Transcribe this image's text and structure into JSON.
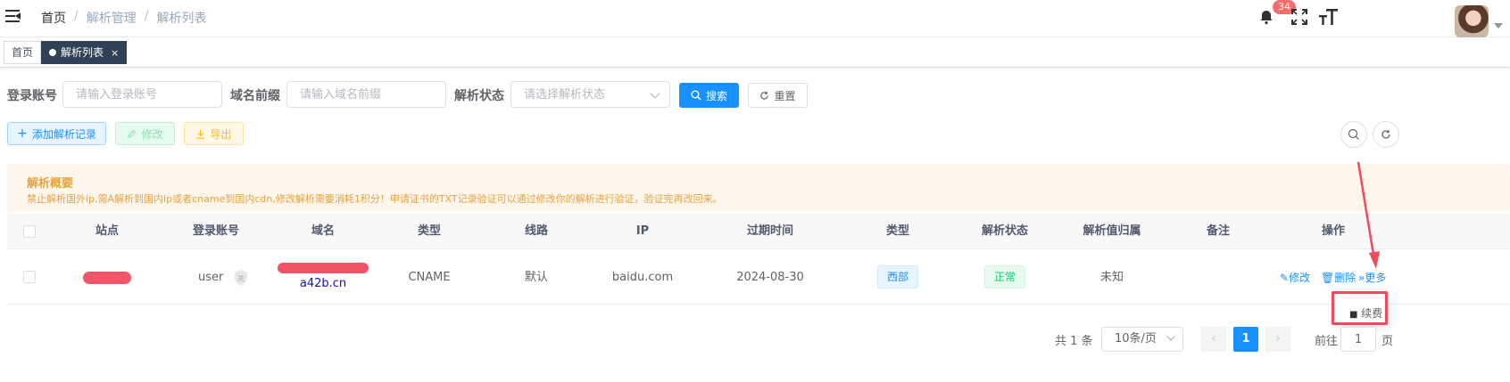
{
  "header": {
    "breadcrumb": [
      "首页",
      "解析管理",
      "解析列表"
    ],
    "notification_count": "34",
    "icons": [
      "hamburger-icon",
      "bell-icon",
      "fullscreen-icon",
      "font-size-icon",
      "avatar"
    ]
  },
  "tags": {
    "home": "首页",
    "active": "解析列表",
    "close": "×"
  },
  "search": {
    "account_label": "登录账号",
    "account_placeholder": "请输入登录账号",
    "prefix_label": "域名前缀",
    "prefix_placeholder": "请输入域名前缀",
    "status_label": "解析状态",
    "status_placeholder": "请选择解析状态",
    "search_button": "搜索",
    "reset_button": "重置"
  },
  "toolbar": {
    "add_button": "添加解析记录",
    "edit_button": "修改",
    "export_button": "导出"
  },
  "alert": {
    "title": "解析概要",
    "description": "禁止解析国外ip,需A解析到国内ip或者cname到国内cdn,修改解析需要消耗1积分！申请证书的TXT记录验证可以通过修改你的解析进行验证，验证完再改回来。"
  },
  "table": {
    "columns": [
      "站点",
      "登录账号",
      "域名",
      "类型",
      "线路",
      "IP",
      "过期时间",
      "类型",
      "解析状态",
      "解析值归属",
      "备注",
      "操作"
    ],
    "rows": [
      {
        "site": "",
        "account": "user",
        "account_badge": "关",
        "domain": "a42b.cn",
        "record_type": "CNAME",
        "line": "默认",
        "ip": "baidu.com",
        "expire": "2024-08-30",
        "region": "西部",
        "status": "正常",
        "value_owner": "未知",
        "remark": "",
        "action_edit": "修改",
        "action_delete": "删除",
        "action_more": "更多"
      }
    ]
  },
  "dropdown": {
    "item": "续费"
  },
  "pagination": {
    "total": "共 1 条",
    "page_size": "10条/页",
    "current_page": "1",
    "goto_prefix": "前往",
    "goto_value": "1",
    "goto_suffix": "页"
  },
  "colors": {
    "primary": "#1890ff",
    "annotation_red": "#ef4b5c",
    "warning": "#e6a23c",
    "success": "#67c23a"
  }
}
